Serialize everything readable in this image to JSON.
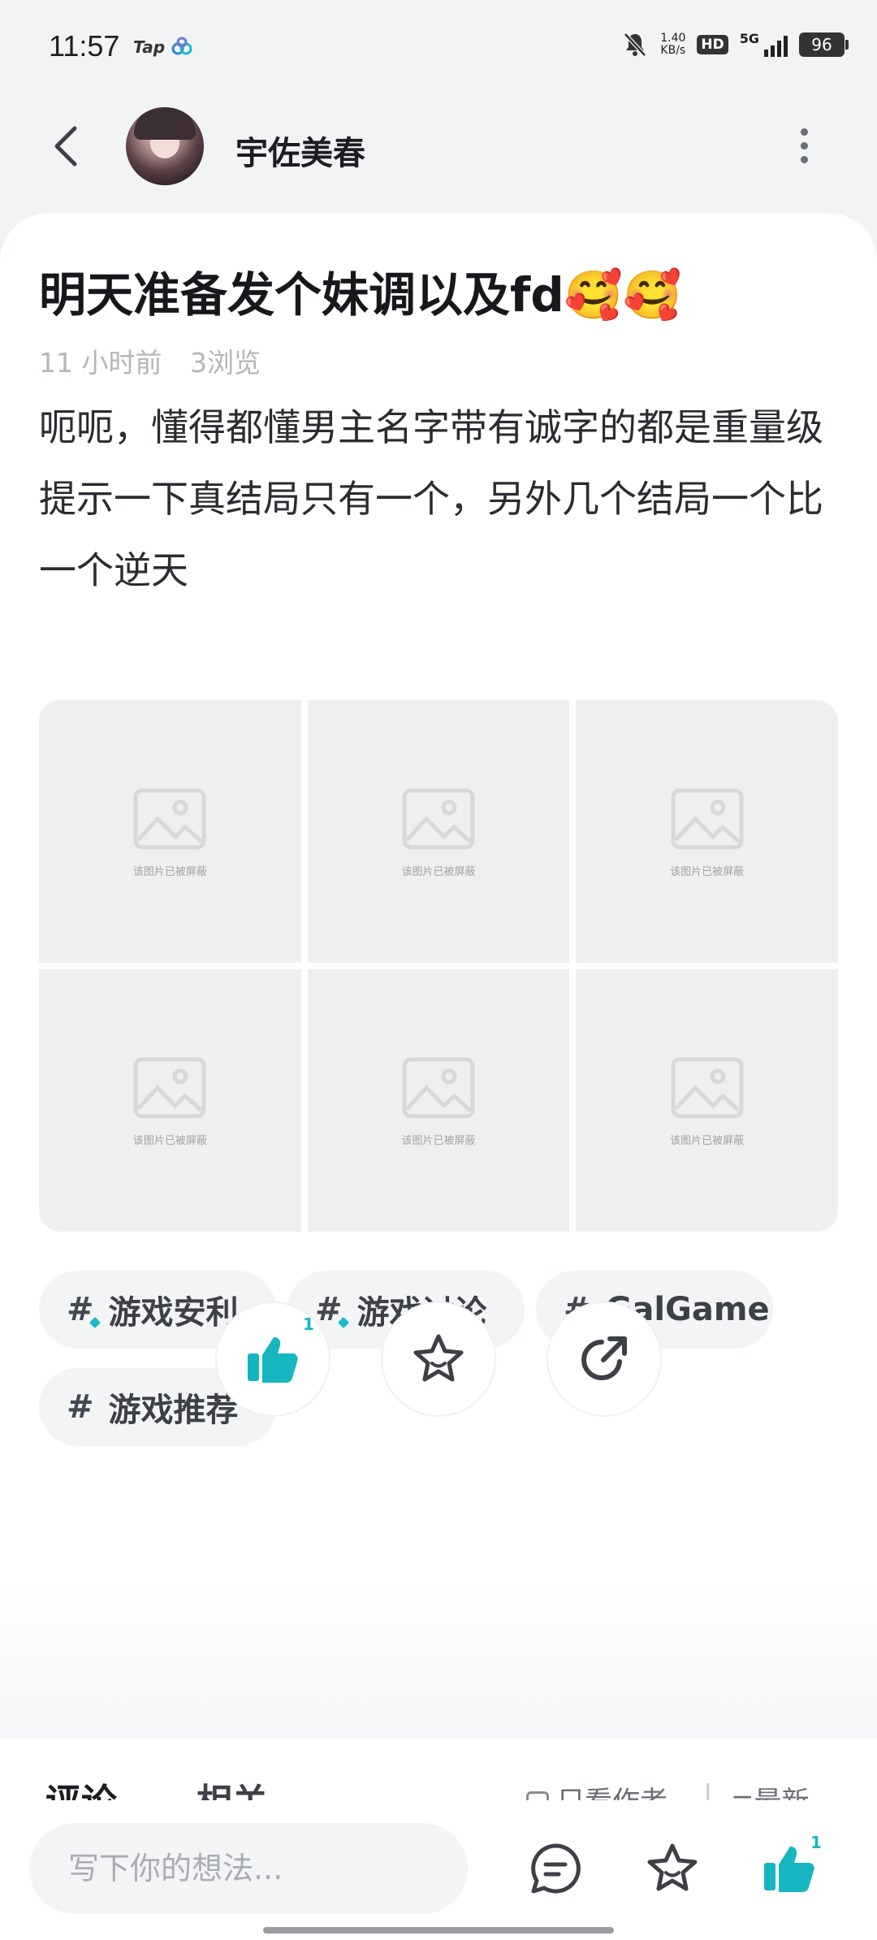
{
  "status_bar": {
    "time": "11:57",
    "app_label": "Tap",
    "net_speed_value": "1.40",
    "net_speed_unit": "KB/s",
    "hd": "HD",
    "network": "5G",
    "battery": "96"
  },
  "header": {
    "username": "宇佐美春"
  },
  "post": {
    "title": "明天准备发个妹调以及fd🥰🥰",
    "time_ago": "11 小时前",
    "views": "3浏览",
    "paragraphs": [
      "呃呃，懂得都懂男主名字带有诚字的都是重量级",
      "提示一下真结局只有一个，另外几个结局一个比一个逆天"
    ],
    "images": [
      {
        "label": "该图片已被屏蔽"
      },
      {
        "label": "该图片已被屏蔽"
      },
      {
        "label": "该图片已被屏蔽"
      },
      {
        "label": "该图片已被屏蔽"
      },
      {
        "label": "该图片已被屏蔽"
      },
      {
        "label": "该图片已被屏蔽"
      }
    ],
    "tags": [
      {
        "hash": "#",
        "label": "游戏安利"
      },
      {
        "hash": "#",
        "label": "游戏讨论"
      },
      {
        "hash": "#",
        "label": "GalGame"
      },
      {
        "hash": "#",
        "label": "游戏推荐"
      }
    ],
    "like_count": "1"
  },
  "comment_tabs": {
    "comments": "评论",
    "related": "相关",
    "author_only": "只看作者",
    "sort": "最新"
  },
  "bottom_bar": {
    "input_placeholder": "写下你的想法...",
    "like_count": "1"
  },
  "colors": {
    "accent": "#15b6c0",
    "tag_bg": "#f3f4f6",
    "page_bg": "#f2f3f5"
  }
}
